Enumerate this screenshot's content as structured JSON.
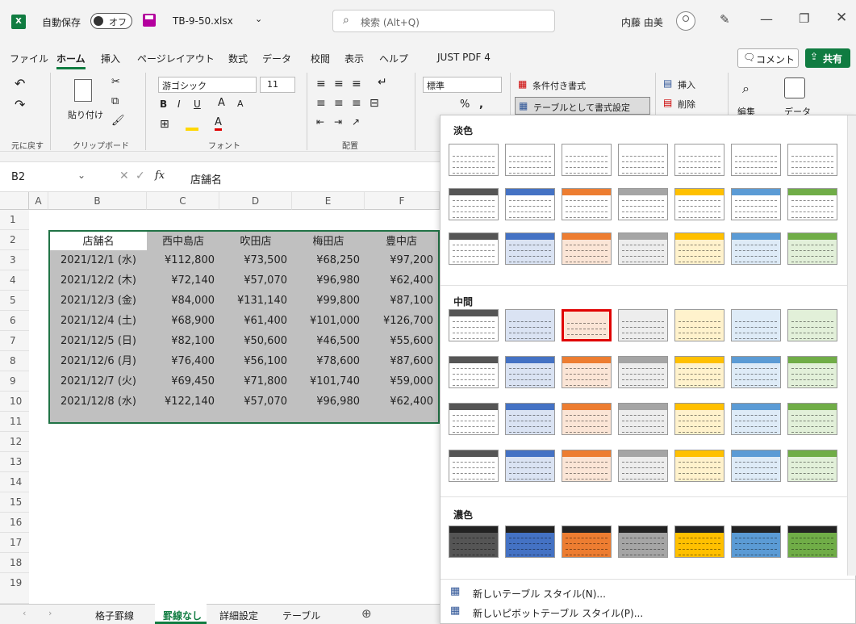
{
  "titlebar": {
    "autosave_label": "自動保存",
    "autosave_state": "オフ",
    "filename": "TB-9-50.xlsx",
    "search_placeholder": "検索 (Alt+Q)",
    "user_name": "内藤 由美"
  },
  "menu": {
    "items": [
      "ファイル",
      "ホーム",
      "挿入",
      "ページレイアウト",
      "数式",
      "データ",
      "校閲",
      "表示",
      "ヘルプ",
      "JUST PDF 4"
    ],
    "active_index": 1,
    "comment_label": "コメント",
    "share_label": "共有"
  },
  "ribbon": {
    "groups": {
      "undo": "元に戻す",
      "clipboard": "クリップボード",
      "font": "フォント",
      "alignment": "配置"
    },
    "paste_label": "貼り付け",
    "font_name": "游ゴシック",
    "font_size": "11",
    "number_format": "標準",
    "conditional_format_label": "条件付き書式",
    "format_as_table_label": "テーブルとして書式設定",
    "insert_label": "挿入",
    "delete_label": "削除",
    "edit_label": "編集",
    "data_label": "データ"
  },
  "formula_bar": {
    "cell_ref": "B2",
    "fx": "fx",
    "content": "店舗名"
  },
  "columns": [
    "A",
    "B",
    "C",
    "D",
    "E",
    "F"
  ],
  "row_numbers": [
    "1",
    "2",
    "3",
    "4",
    "5",
    "6",
    "7",
    "8",
    "9",
    "10",
    "11",
    "12",
    "13",
    "14",
    "15",
    "16",
    "17",
    "18",
    "19"
  ],
  "table": {
    "headers": [
      "店舗名",
      "西中島店",
      "吹田店",
      "梅田店",
      "豊中店"
    ],
    "rows": [
      [
        "2021/12/1 (水)",
        "¥112,800",
        "¥73,500",
        "¥68,250",
        "¥97,200"
      ],
      [
        "2021/12/2 (木)",
        "¥72,140",
        "¥57,070",
        "¥96,980",
        "¥62,400"
      ],
      [
        "2021/12/3 (金)",
        "¥84,000",
        "¥131,140",
        "¥99,800",
        "¥87,100"
      ],
      [
        "2021/12/4 (土)",
        "¥68,900",
        "¥61,400",
        "¥101,000",
        "¥126,700"
      ],
      [
        "2021/12/5 (日)",
        "¥82,100",
        "¥50,600",
        "¥46,500",
        "¥55,600"
      ],
      [
        "2021/12/6 (月)",
        "¥76,400",
        "¥56,100",
        "¥78,600",
        "¥87,600"
      ],
      [
        "2021/12/7 (火)",
        "¥69,450",
        "¥71,800",
        "¥101,740",
        "¥59,000"
      ],
      [
        "2021/12/8 (水)",
        "¥122,140",
        "¥57,070",
        "¥96,980",
        "¥62,400"
      ]
    ]
  },
  "sheet_tabs": [
    "格子罫線",
    "罫線なし",
    "詳細設定",
    "テーブル"
  ],
  "active_sheet_index": 1,
  "gallery": {
    "section_light": "淡色",
    "section_medium": "中間",
    "section_dark": "濃色",
    "new_table_style": "新しいテーブル スタイル(N)...",
    "new_pivot_style": "新しいピボットテーブル スタイル(P)...",
    "palette": [
      "#555555",
      "#4472c4",
      "#ed7d31",
      "#a5a5a5",
      "#ffc000",
      "#5b9bd5",
      "#70ad47"
    ],
    "light_fill": [
      "#ffffff",
      "#dae3f3",
      "#fbe5d6",
      "#ededed",
      "#fff2cc",
      "#deebf7",
      "#e2f0d9"
    ],
    "selected_color": "#e00000"
  },
  "colors": {
    "excel_green": "#107c41",
    "table_fill": "#c0c0c0"
  }
}
